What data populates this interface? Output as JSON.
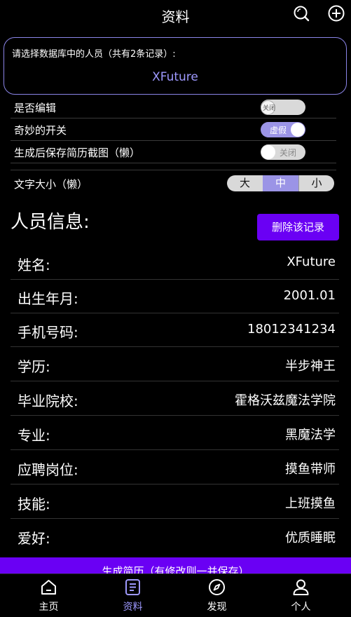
{
  "header": {
    "title": "资料",
    "search_icon": "search-icon",
    "add_icon": "plus-circle-icon"
  },
  "picker": {
    "prompt": "请选择数据库中的人员（共有2条记录）:",
    "selected": "XFuture"
  },
  "settings": {
    "edit": {
      "label": "是否编辑",
      "toggle_text": "关闭"
    },
    "magic": {
      "label": "奇妙的开关",
      "toggle_text": "虚假"
    },
    "save_screenshot": {
      "label": "生成后保存简历截图（懒）",
      "toggle_text": "关闭"
    },
    "font_size": {
      "label": "文字大小（懒）",
      "options": [
        "大",
        "中",
        "小"
      ],
      "selected": "中"
    }
  },
  "section": {
    "title": "人员信息:",
    "delete_button": "删除该记录"
  },
  "fields": [
    {
      "key": "姓名:",
      "value": "XFuture"
    },
    {
      "key": "出生年月:",
      "value": "2001.01"
    },
    {
      "key": "手机号码:",
      "value": "18012341234"
    },
    {
      "key": "学历:",
      "value": "半步神王"
    },
    {
      "key": "毕业院校:",
      "value": "霍格沃兹魔法学院"
    },
    {
      "key": "专业:",
      "value": "黑魔法学"
    },
    {
      "key": "应聘岗位:",
      "value": "摸鱼带师"
    },
    {
      "key": "技能:",
      "value": "上班摸鱼"
    },
    {
      "key": "爱好:",
      "value": "优质睡眠"
    }
  ],
  "generate_button": "生成简历（有修改则一并保存）",
  "nav": [
    {
      "label": "主页",
      "icon": "home-icon"
    },
    {
      "label": "资料",
      "icon": "document-icon"
    },
    {
      "label": "发现",
      "icon": "compass-icon"
    },
    {
      "label": "个人",
      "icon": "user-icon"
    }
  ],
  "colors": {
    "accent": "#6a00f4",
    "accent_light": "#9e99ff",
    "background": "#000000"
  }
}
